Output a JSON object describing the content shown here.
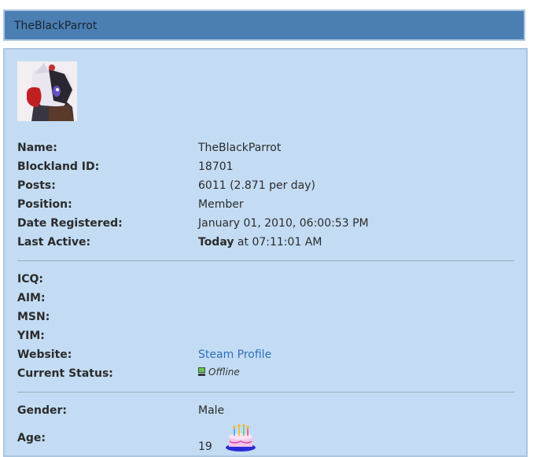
{
  "header": {
    "title": "TheBlackParrot"
  },
  "profile": {
    "avatar_icon": "user-avatar-parrot",
    "basic": [
      {
        "label": "Name:",
        "value": "TheBlackParrot"
      },
      {
        "label": "Blockland ID:",
        "value": "18701"
      },
      {
        "label": "Posts:",
        "value": "6011 (2.871 per day)"
      },
      {
        "label": "Position:",
        "value": "Member"
      },
      {
        "label": "Date Registered:",
        "value": "January 01, 2010, 06:00:53 PM"
      }
    ],
    "last_active": {
      "label": "Last Active:",
      "bold": "Today",
      "rest": " at 07:11:01 AM"
    },
    "contact": [
      {
        "label": "ICQ:"
      },
      {
        "label": "AIM:"
      },
      {
        "label": "MSN:"
      },
      {
        "label": "YIM:"
      }
    ],
    "website": {
      "label": "Website:",
      "link_text": "Steam Profile"
    },
    "status": {
      "label": "Current Status:",
      "text": "Offline",
      "icon": "offline-computer-icon"
    },
    "gender": {
      "label": "Gender:",
      "value": "Male"
    },
    "age": {
      "label": "Age:",
      "value": "19",
      "icon": "birthday-cake-icon"
    }
  },
  "colors": {
    "header_bg": "#4b7fb3",
    "panel_bg": "#c3dcf4",
    "link": "#2f6fb8"
  }
}
